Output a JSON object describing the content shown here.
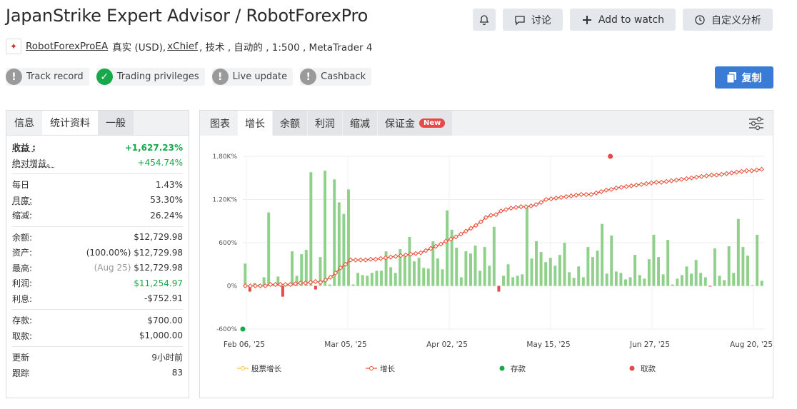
{
  "header": {
    "title": "JapanStrike Expert Advisor / RobotForexPro",
    "buttons": {
      "discuss": "讨论",
      "watch": "Add to watch",
      "custom": "自定义分析"
    }
  },
  "subline": {
    "account": "RobotForexProEA",
    "type": "真实 (USD),",
    "broker": "xChief",
    "rest": ", 技术 , 自动的 , 1:500 , MetaTrader 4"
  },
  "badges": [
    {
      "label": "Track record",
      "status": "!"
    },
    {
      "label": "Trading privileges",
      "status": "✓"
    },
    {
      "label": "Live update",
      "status": "!"
    },
    {
      "label": "Cashback",
      "status": "!"
    }
  ],
  "copy_label": "复制",
  "left_tabs": [
    "信息",
    "统计资料",
    "一般"
  ],
  "stats": {
    "gain": {
      "k": "收益 :",
      "v": "+1,627.23%"
    },
    "abs_gain": {
      "k": "绝对增益。",
      "v": "+454.74%"
    },
    "daily": {
      "k": "每日",
      "v": "1.43%"
    },
    "monthly": {
      "k": "月度:",
      "v": "53.30%"
    },
    "drawdown": {
      "k": "缩减:",
      "v": "26.24%"
    },
    "balance": {
      "k": "余额:",
      "v": "$12,729.98"
    },
    "equity": {
      "k": "资产:",
      "pct": "(100.00%)",
      "v": "$12,729.98"
    },
    "highest": {
      "k": "最高:",
      "date": "(Aug 25)",
      "v": "$12,729.98"
    },
    "profit": {
      "k": "利润:",
      "v": "$11,254.97"
    },
    "interest": {
      "k": "利息:",
      "v": "-$752.91"
    },
    "deposits": {
      "k": "存款:",
      "v": "$700.00"
    },
    "withdrawals": {
      "k": "取款:",
      "v": "$1,000.00"
    },
    "updated": {
      "k": "更新",
      "v": "9小时前"
    },
    "tracking": {
      "k": "跟踪",
      "v": "83"
    }
  },
  "right_tabs": [
    "图表",
    "增长",
    "余额",
    "利润",
    "缩减",
    "保证金"
  ],
  "new_badge": "New",
  "chart_data": {
    "type": "bar+line",
    "y_ticks": [
      "1.80K%",
      "1.20K%",
      "600%",
      "0%",
      "-600%"
    ],
    "ylim": [
      -600,
      1800
    ],
    "x_ticks": [
      "Feb 06, '25",
      "Mar 05, '25",
      "Apr 02, '25",
      "May 15, '25",
      "Jun 27, '25",
      "Aug 20, '25"
    ],
    "legend": [
      "股票增长",
      "增长",
      "存款",
      "取款"
    ],
    "colors": {
      "bar_pos": "#8fd18b",
      "bar_neg": "#e84848",
      "growth": "#e8503a",
      "equity": "#f5c542",
      "deposit": "#17a84a",
      "withdrawal": "#e84848"
    },
    "bars": [
      310,
      -80,
      40,
      20,
      120,
      1020,
      20,
      130,
      -150,
      30,
      480,
      140,
      440,
      500,
      1580,
      -50,
      400,
      1600,
      20,
      1480,
      1160,
      1000,
      1340,
      20,
      180,
      150,
      140,
      180,
      210,
      210,
      480,
      260,
      180,
      510,
      410,
      680,
      340,
      390,
      250,
      240,
      620,
      380,
      230,
      1050,
      780,
      530,
      120,
      480,
      450,
      560,
      210,
      540,
      280,
      820,
      -80,
      140,
      300,
      120,
      140,
      160,
      1090,
      380,
      620,
      470,
      330,
      390,
      280,
      430,
      600,
      190,
      110,
      270,
      120,
      540,
      400,
      490,
      860,
      170,
      700,
      200,
      180,
      90,
      120,
      430,
      150,
      100,
      370,
      710,
      400,
      160,
      640,
      20,
      100,
      150,
      270,
      170,
      360,
      180,
      120,
      -10,
      520,
      140,
      80,
      550,
      180,
      930,
      540,
      420,
      10,
      710,
      70
    ],
    "growth": [
      0,
      0,
      0,
      0,
      0,
      20,
      20,
      20,
      20,
      20,
      30,
      40,
      40,
      50,
      60,
      50,
      80,
      120,
      180,
      250,
      300,
      360,
      360,
      360,
      360,
      370,
      370,
      380,
      390,
      400,
      410,
      420,
      430,
      440,
      450,
      460,
      490,
      520,
      550,
      580,
      620,
      650,
      680,
      720,
      760,
      800,
      840,
      890,
      950,
      980,
      990,
      1040,
      1060,
      1080,
      1090,
      1100,
      1100,
      1110,
      1130,
      1160,
      1200,
      1210,
      1220,
      1230,
      1240,
      1250,
      1260,
      1270,
      1270,
      1270,
      1290,
      1310,
      1330,
      1340,
      1360,
      1370,
      1380,
      1390,
      1400,
      1410,
      1420,
      1430,
      1440,
      1440,
      1450,
      1460,
      1470,
      1480,
      1490,
      1500,
      1510,
      1520,
      1530,
      1540,
      1540,
      1550,
      1560,
      1570,
      1580,
      1590,
      1600,
      1600,
      1610,
      1620
    ]
  }
}
